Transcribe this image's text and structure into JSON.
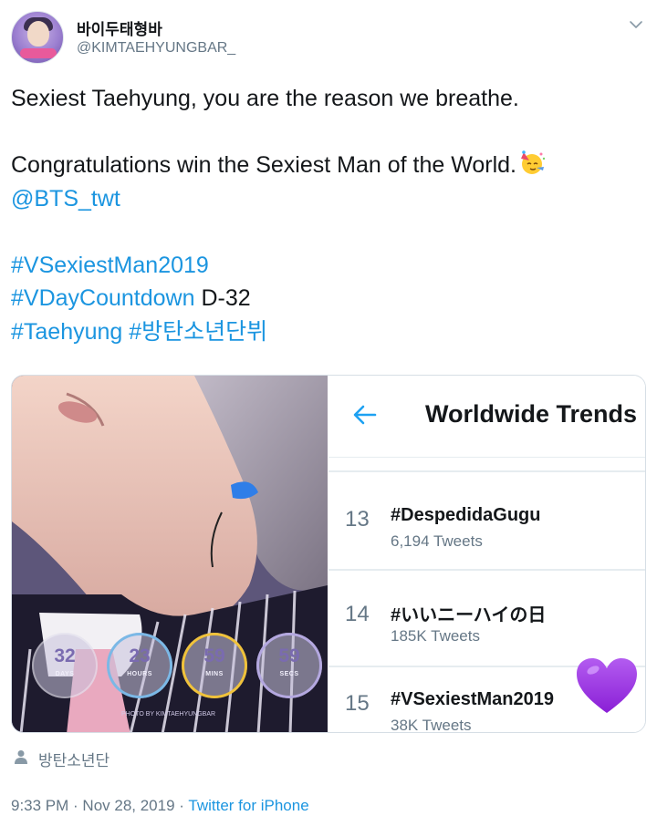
{
  "user": {
    "display_name": "바이두태형바",
    "handle": "@KIMTAEHYUNGBAR_",
    "avatar_icon": "profile-avatar",
    "menu_icon": "chevron-down-icon"
  },
  "tweet": {
    "line1": "Sexiest Taehyung, you are the reason we breathe.",
    "line2": "Congratulations win the Sexiest Man of the World.",
    "party_emoji": "partying-face-emoji",
    "mention": "@BTS_twt",
    "hashtag1": "#VSexiestMan2019",
    "hashtag2": "#VDayCountdown",
    "countdown_text": "D-32",
    "hashtag3": "#Taehyung",
    "hashtag4": "#방탄소년단뷔"
  },
  "media": {
    "photo": {
      "countdown": [
        {
          "value": "32",
          "unit": "DAYS"
        },
        {
          "value": "23",
          "unit": "HOURS"
        },
        {
          "value": "59",
          "unit": "MINS"
        },
        {
          "value": "59",
          "unit": "SECS"
        }
      ],
      "watermark": "PHOTO BY KIMTAEHYUNGBAR"
    },
    "trends": {
      "title": "Worldwide Trends",
      "back_icon": "back-arrow-icon",
      "items": [
        {
          "rank": "13",
          "name": "#DespedidaGugu",
          "count": "6,194 Tweets"
        },
        {
          "rank": "14",
          "name": "#いいニーハイの日",
          "count": "185K Tweets"
        },
        {
          "rank": "15",
          "name": "#VSexiestMan2019",
          "count": "38K Tweets"
        }
      ],
      "heart_icon": "purple-heart-emoji"
    }
  },
  "tagged": {
    "icon": "person-icon",
    "label": "방탄소년단"
  },
  "meta": {
    "time": "9:33 PM",
    "separator1": " · ",
    "date": "Nov 28, 2019",
    "separator2": " · ",
    "source": "Twitter for iPhone"
  },
  "colors": {
    "link": "#1b95e0",
    "secondary_text": "#657786",
    "heart": "#9b30e0"
  }
}
